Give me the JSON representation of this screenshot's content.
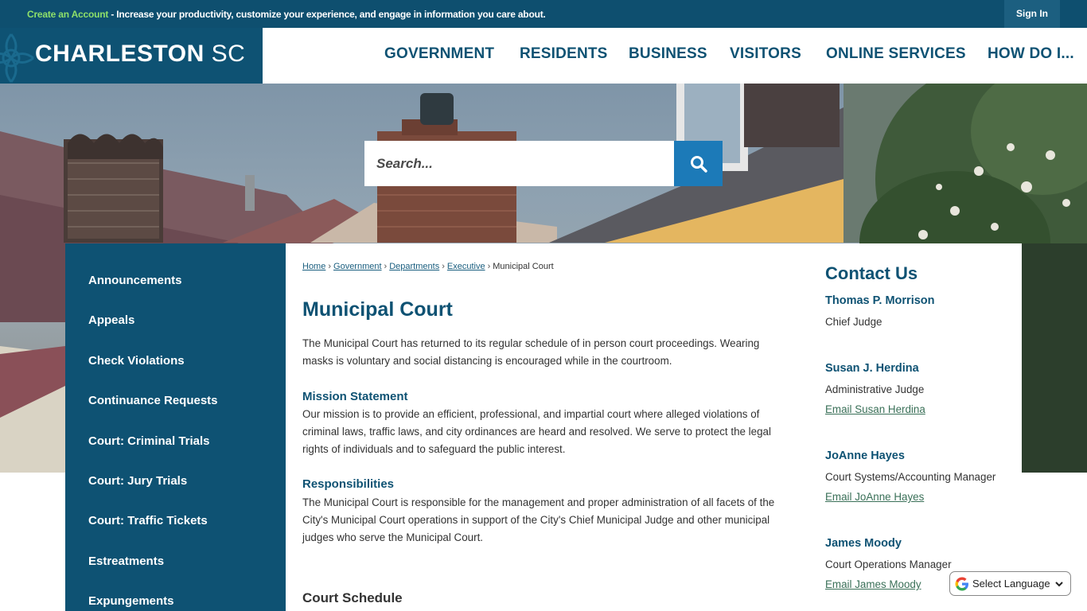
{
  "topbar": {
    "account_link": "Create an Account",
    "message": " - Increase your productivity, customize your experience, and engage in information you care about.",
    "sign_in": "Sign In"
  },
  "header": {
    "logo_main": "CHARLESTON",
    "logo_suffix": "SC",
    "nav": [
      "GOVERNMENT",
      "RESIDENTS",
      "BUSINESS",
      "VISITORS",
      "ONLINE SERVICES",
      "HOW DO I..."
    ]
  },
  "search": {
    "placeholder": "Search..."
  },
  "sidebar": {
    "items": [
      "Announcements",
      "Appeals",
      "Check Violations",
      "Continuance Requests",
      "Court: Criminal Trials",
      "Court: Jury Trials",
      "Court: Traffic Tickets",
      "Estreatments",
      "Expungements"
    ]
  },
  "breadcrumb": {
    "links": [
      "Home",
      "Government",
      "Departments",
      "Executive"
    ],
    "current": "Municipal Court"
  },
  "main": {
    "title": "Municipal Court",
    "intro": "The Municipal Court has returned to its regular schedule of in person court proceedings.  Wearing masks is voluntary and social distancing is encouraged while in the courtroom.",
    "mission_heading": "Mission Statement",
    "mission_text": "Our mission is to provide an efficient, professional, and impartial court where alleged violations of criminal laws, traffic laws, and city ordinances are heard and resolved.  We serve to protect the legal rights of individuals and to safeguard the public interest.",
    "responsibilities_heading": "Responsibilities",
    "responsibilities_text": "The Municipal Court is responsible for the management and proper administration of all facets of the City's Municipal Court operations in support of the City's Chief Municipal Judge and other municipal judges who serve the Municipal Court.",
    "schedule_heading": "Court Schedule"
  },
  "contact": {
    "heading": "Contact Us",
    "people": [
      {
        "name": "Thomas P. Morrison",
        "role": "Chief Judge",
        "email": ""
      },
      {
        "name": "Susan J. Herdina",
        "role": "Administrative Judge",
        "email": "Email Susan Herdina"
      },
      {
        "name": "JoAnne Hayes",
        "role": "Court Systems/Accounting Manager",
        "email": "Email JoAnne Hayes"
      },
      {
        "name": "James Moody",
        "role": "Court Operations Manager",
        "email": "Email James Moody"
      }
    ]
  },
  "translate": {
    "label": "Select Language"
  },
  "colors": {
    "brand_dark": "#0e5273",
    "topbar": "#0e4f6f",
    "search_button": "#1c7ab8",
    "account_link": "#8ee06a",
    "email_link": "#3a7058"
  },
  "icons": {
    "search": "search-icon",
    "google": "google-g-icon",
    "dropdown": "chevron-down-icon",
    "logo_flourish": "palmetto-flourish-icon"
  }
}
